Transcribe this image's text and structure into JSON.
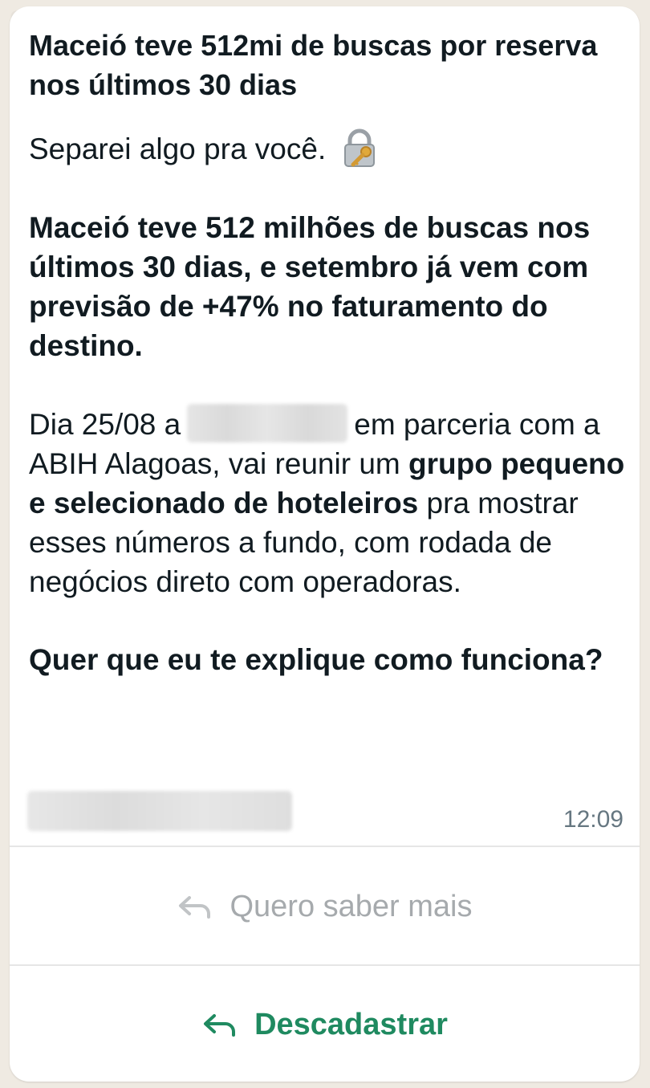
{
  "message": {
    "title": "Maceió teve 512mi de buscas por reserva nos últimos 30 dias",
    "intro": "Separei algo pra você.",
    "intro_icon": "lock-with-key-icon",
    "headline": "Maceió teve 512 milhões de buscas nos últimos 30 dias, e setembro já vem com previsão de +47% no faturamento do destino.",
    "paragraph_start": "Dia 25/08 a",
    "paragraph_after_redaction": "em parceria com a ABIH Alagoas, vai reunir um",
    "paragraph_bold": "grupo pequeno e selecionado de hoteleiros",
    "paragraph_end": "pra mostrar esses números a fundo, com rodada de negócios direto com operadoras.",
    "question": "Quer que eu te explique como funciona?",
    "time": "12:09"
  },
  "buttons": {
    "quick_reply_1": "Quero saber mais",
    "quick_reply_2": "Descadastrar"
  },
  "colors": {
    "background": "#efeae2",
    "bubble": "#ffffff",
    "text": "#111b21",
    "muted": "#667781",
    "disabled_button": "#a6aaad",
    "active_button": "#1f8a60"
  }
}
